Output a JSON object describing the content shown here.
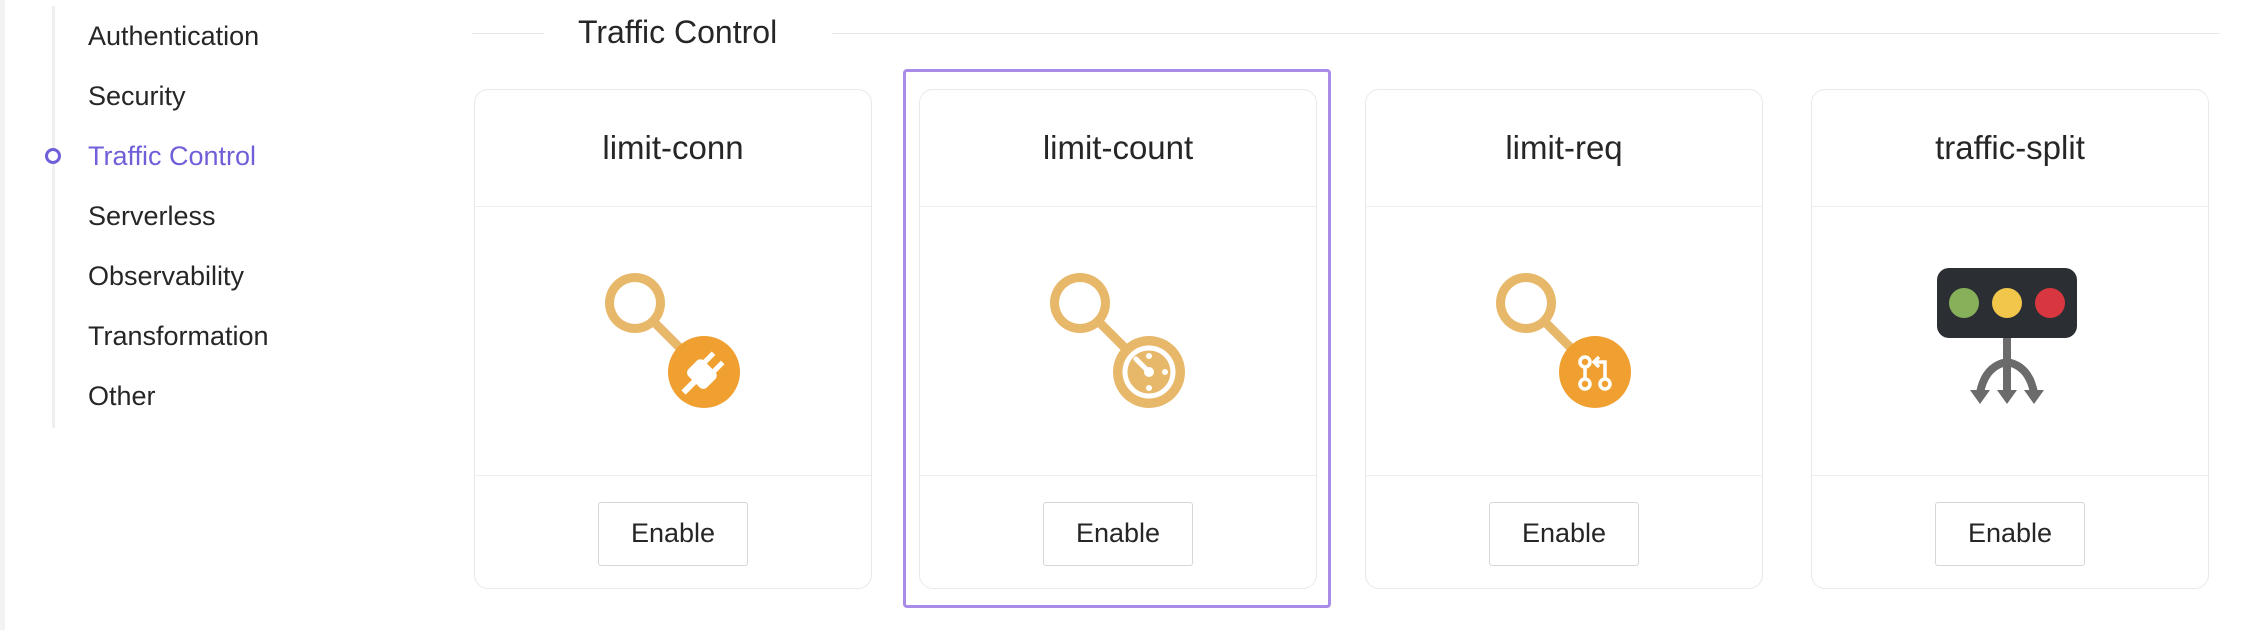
{
  "sidebar": {
    "items": [
      {
        "label": "Authentication",
        "active": false
      },
      {
        "label": "Security",
        "active": false
      },
      {
        "label": "Traffic Control",
        "active": true
      },
      {
        "label": "Serverless",
        "active": false
      },
      {
        "label": "Observability",
        "active": false
      },
      {
        "label": "Transformation",
        "active": false
      },
      {
        "label": "Other",
        "active": false
      }
    ]
  },
  "section": {
    "title": "Traffic Control"
  },
  "cards": [
    {
      "name": "limit-conn",
      "icon": "limit-conn-plug-icon",
      "button": "Enable"
    },
    {
      "name": "limit-count",
      "icon": "limit-count-gauge-icon",
      "button": "Enable",
      "highlighted": true
    },
    {
      "name": "limit-req",
      "icon": "limit-req-branch-icon",
      "button": "Enable"
    },
    {
      "name": "traffic-split",
      "icon": "traffic-light-split-icon",
      "button": "Enable"
    }
  ],
  "colors": {
    "accent": "#6f5fd9",
    "highlight_border": "#a98be8",
    "icon_orange": "#f0a030",
    "icon_light_orange": "#e8b86a"
  }
}
